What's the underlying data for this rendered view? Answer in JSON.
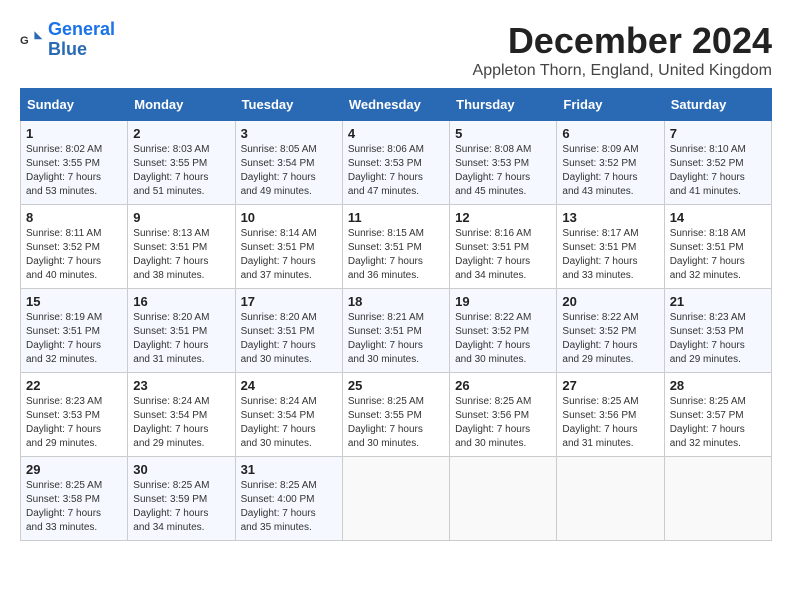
{
  "header": {
    "logo_line1": "General",
    "logo_line2": "Blue",
    "month_year": "December 2024",
    "location": "Appleton Thorn, England, United Kingdom"
  },
  "days_of_week": [
    "Sunday",
    "Monday",
    "Tuesday",
    "Wednesday",
    "Thursday",
    "Friday",
    "Saturday"
  ],
  "weeks": [
    [
      {
        "day": "1",
        "lines": [
          "Sunrise: 8:02 AM",
          "Sunset: 3:55 PM",
          "Daylight: 7 hours",
          "and 53 minutes."
        ]
      },
      {
        "day": "2",
        "lines": [
          "Sunrise: 8:03 AM",
          "Sunset: 3:55 PM",
          "Daylight: 7 hours",
          "and 51 minutes."
        ]
      },
      {
        "day": "3",
        "lines": [
          "Sunrise: 8:05 AM",
          "Sunset: 3:54 PM",
          "Daylight: 7 hours",
          "and 49 minutes."
        ]
      },
      {
        "day": "4",
        "lines": [
          "Sunrise: 8:06 AM",
          "Sunset: 3:53 PM",
          "Daylight: 7 hours",
          "and 47 minutes."
        ]
      },
      {
        "day": "5",
        "lines": [
          "Sunrise: 8:08 AM",
          "Sunset: 3:53 PM",
          "Daylight: 7 hours",
          "and 45 minutes."
        ]
      },
      {
        "day": "6",
        "lines": [
          "Sunrise: 8:09 AM",
          "Sunset: 3:52 PM",
          "Daylight: 7 hours",
          "and 43 minutes."
        ]
      },
      {
        "day": "7",
        "lines": [
          "Sunrise: 8:10 AM",
          "Sunset: 3:52 PM",
          "Daylight: 7 hours",
          "and 41 minutes."
        ]
      }
    ],
    [
      {
        "day": "8",
        "lines": [
          "Sunrise: 8:11 AM",
          "Sunset: 3:52 PM",
          "Daylight: 7 hours",
          "and 40 minutes."
        ]
      },
      {
        "day": "9",
        "lines": [
          "Sunrise: 8:13 AM",
          "Sunset: 3:51 PM",
          "Daylight: 7 hours",
          "and 38 minutes."
        ]
      },
      {
        "day": "10",
        "lines": [
          "Sunrise: 8:14 AM",
          "Sunset: 3:51 PM",
          "Daylight: 7 hours",
          "and 37 minutes."
        ]
      },
      {
        "day": "11",
        "lines": [
          "Sunrise: 8:15 AM",
          "Sunset: 3:51 PM",
          "Daylight: 7 hours",
          "and 36 minutes."
        ]
      },
      {
        "day": "12",
        "lines": [
          "Sunrise: 8:16 AM",
          "Sunset: 3:51 PM",
          "Daylight: 7 hours",
          "and 34 minutes."
        ]
      },
      {
        "day": "13",
        "lines": [
          "Sunrise: 8:17 AM",
          "Sunset: 3:51 PM",
          "Daylight: 7 hours",
          "and 33 minutes."
        ]
      },
      {
        "day": "14",
        "lines": [
          "Sunrise: 8:18 AM",
          "Sunset: 3:51 PM",
          "Daylight: 7 hours",
          "and 32 minutes."
        ]
      }
    ],
    [
      {
        "day": "15",
        "lines": [
          "Sunrise: 8:19 AM",
          "Sunset: 3:51 PM",
          "Daylight: 7 hours",
          "and 32 minutes."
        ]
      },
      {
        "day": "16",
        "lines": [
          "Sunrise: 8:20 AM",
          "Sunset: 3:51 PM",
          "Daylight: 7 hours",
          "and 31 minutes."
        ]
      },
      {
        "day": "17",
        "lines": [
          "Sunrise: 8:20 AM",
          "Sunset: 3:51 PM",
          "Daylight: 7 hours",
          "and 30 minutes."
        ]
      },
      {
        "day": "18",
        "lines": [
          "Sunrise: 8:21 AM",
          "Sunset: 3:51 PM",
          "Daylight: 7 hours",
          "and 30 minutes."
        ]
      },
      {
        "day": "19",
        "lines": [
          "Sunrise: 8:22 AM",
          "Sunset: 3:52 PM",
          "Daylight: 7 hours",
          "and 30 minutes."
        ]
      },
      {
        "day": "20",
        "lines": [
          "Sunrise: 8:22 AM",
          "Sunset: 3:52 PM",
          "Daylight: 7 hours",
          "and 29 minutes."
        ]
      },
      {
        "day": "21",
        "lines": [
          "Sunrise: 8:23 AM",
          "Sunset: 3:53 PM",
          "Daylight: 7 hours",
          "and 29 minutes."
        ]
      }
    ],
    [
      {
        "day": "22",
        "lines": [
          "Sunrise: 8:23 AM",
          "Sunset: 3:53 PM",
          "Daylight: 7 hours",
          "and 29 minutes."
        ]
      },
      {
        "day": "23",
        "lines": [
          "Sunrise: 8:24 AM",
          "Sunset: 3:54 PM",
          "Daylight: 7 hours",
          "and 29 minutes."
        ]
      },
      {
        "day": "24",
        "lines": [
          "Sunrise: 8:24 AM",
          "Sunset: 3:54 PM",
          "Daylight: 7 hours",
          "and 30 minutes."
        ]
      },
      {
        "day": "25",
        "lines": [
          "Sunrise: 8:25 AM",
          "Sunset: 3:55 PM",
          "Daylight: 7 hours",
          "and 30 minutes."
        ]
      },
      {
        "day": "26",
        "lines": [
          "Sunrise: 8:25 AM",
          "Sunset: 3:56 PM",
          "Daylight: 7 hours",
          "and 30 minutes."
        ]
      },
      {
        "day": "27",
        "lines": [
          "Sunrise: 8:25 AM",
          "Sunset: 3:56 PM",
          "Daylight: 7 hours",
          "and 31 minutes."
        ]
      },
      {
        "day": "28",
        "lines": [
          "Sunrise: 8:25 AM",
          "Sunset: 3:57 PM",
          "Daylight: 7 hours",
          "and 32 minutes."
        ]
      }
    ],
    [
      {
        "day": "29",
        "lines": [
          "Sunrise: 8:25 AM",
          "Sunset: 3:58 PM",
          "Daylight: 7 hours",
          "and 33 minutes."
        ]
      },
      {
        "day": "30",
        "lines": [
          "Sunrise: 8:25 AM",
          "Sunset: 3:59 PM",
          "Daylight: 7 hours",
          "and 34 minutes."
        ]
      },
      {
        "day": "31",
        "lines": [
          "Sunrise: 8:25 AM",
          "Sunset: 4:00 PM",
          "Daylight: 7 hours",
          "and 35 minutes."
        ]
      },
      {
        "day": "",
        "lines": []
      },
      {
        "day": "",
        "lines": []
      },
      {
        "day": "",
        "lines": []
      },
      {
        "day": "",
        "lines": []
      }
    ]
  ]
}
